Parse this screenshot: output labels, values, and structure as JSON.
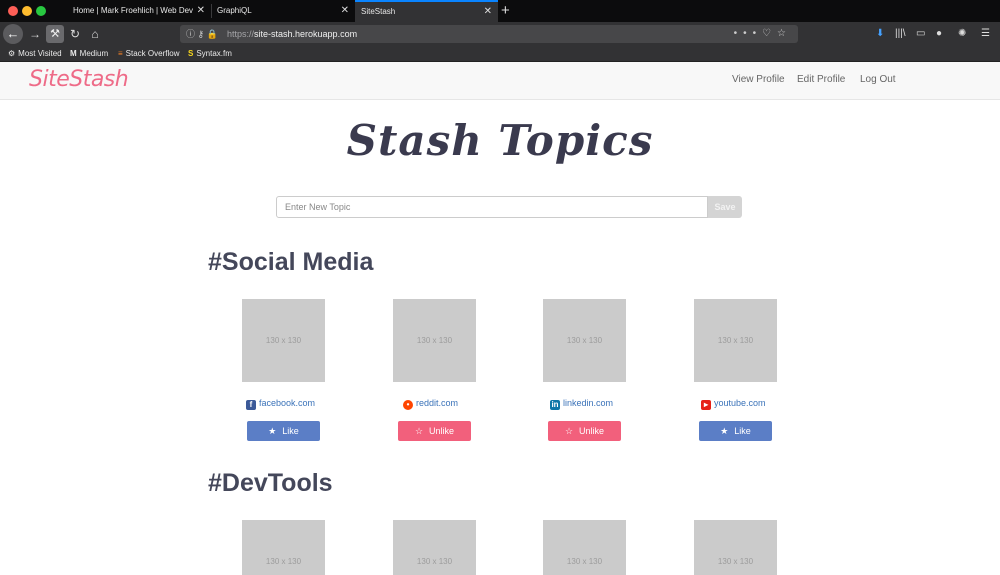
{
  "browser": {
    "tabs": [
      {
        "title": "Home | Mark Froehlich | Web Dev"
      },
      {
        "title": "GraphiQL"
      },
      {
        "title": "SiteStash"
      }
    ],
    "new_tab": "+",
    "close_glyph": "✕",
    "url_scheme": "https://",
    "url_host": "site-stash.herokuapp.com",
    "bookmarks": [
      {
        "label": "Most Visited",
        "icon": "gear-icon"
      },
      {
        "label": "Medium",
        "icon": "medium-logo-icon"
      },
      {
        "label": "Stack Overflow",
        "icon": "stackoverflow-icon"
      },
      {
        "label": "Syntax.fm",
        "icon": "syntax-icon"
      }
    ]
  },
  "app": {
    "brand": "SiteStash",
    "nav": [
      "View Profile",
      "Edit Profile",
      "Log Out"
    ],
    "page_title": "Stash Topics",
    "new_topic": {
      "placeholder": "Enter New Topic",
      "value": "",
      "save_label": "Save"
    },
    "thumb_label": "130 x 130",
    "colors": {
      "brand": "#ee6b88",
      "like": "#5b7ec6",
      "unlike": "#f2607c",
      "link": "#3b73b9"
    },
    "sections": [
      {
        "title": "#Social Media",
        "sites": [
          {
            "name": "facebook.com",
            "icon": "facebook-icon",
            "action": "Like",
            "liked": false
          },
          {
            "name": "reddit.com",
            "icon": "reddit-icon",
            "action": "Unlike",
            "liked": true
          },
          {
            "name": "linkedin.com",
            "icon": "linkedin-icon",
            "action": "Unlike",
            "liked": true
          },
          {
            "name": "youtube.com",
            "icon": "youtube-icon",
            "action": "Like",
            "liked": false
          }
        ]
      },
      {
        "title": "#DevTools",
        "sites": [
          {},
          {},
          {},
          {}
        ]
      }
    ]
  }
}
